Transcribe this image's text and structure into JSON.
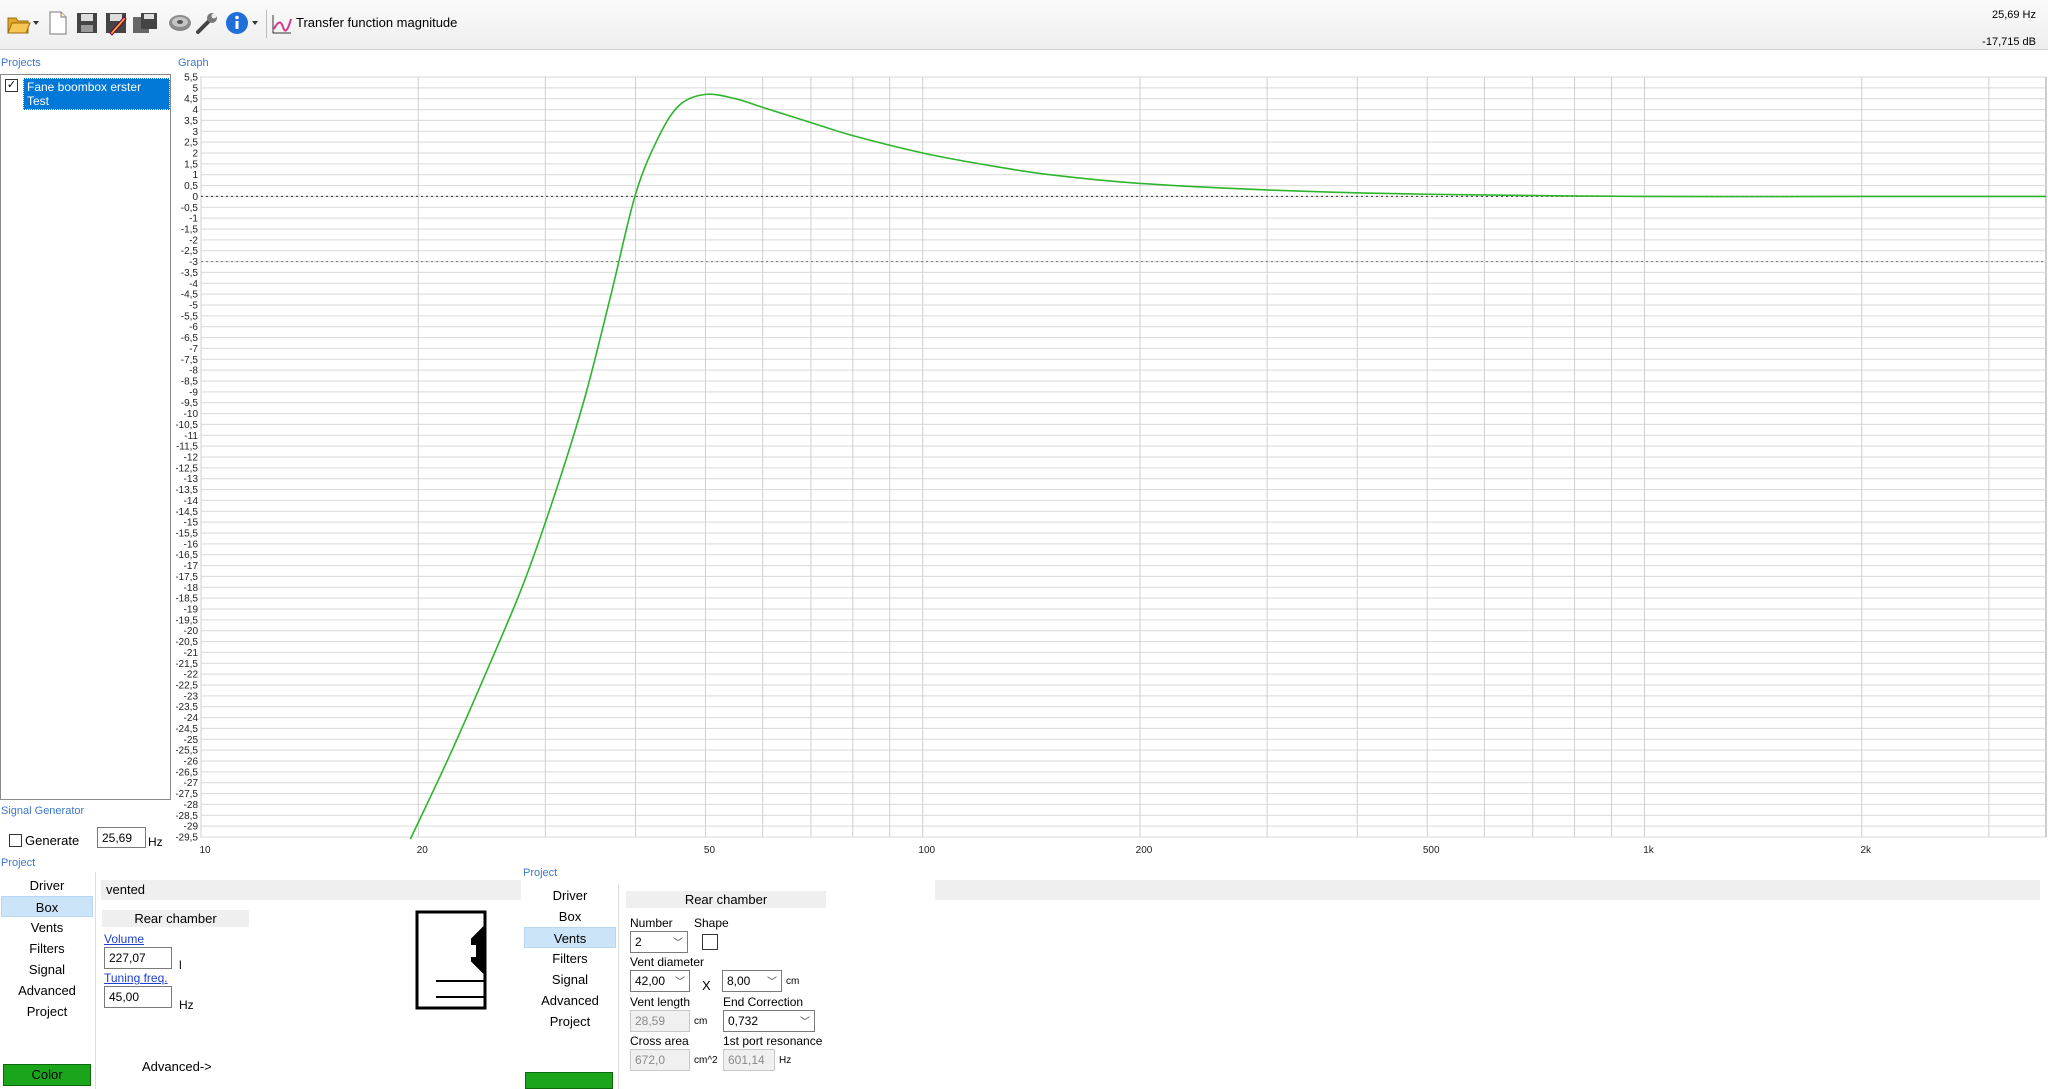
{
  "toolbar": {
    "title": "Transfer function magnitude",
    "readout_hz": "25,69 Hz",
    "readout_db": "-17,715 dB",
    "icons": [
      "open-folder-icon",
      "new-file-icon",
      "save-icon",
      "save-as-icon",
      "save-all-icon",
      "speaker-icon",
      "wrench-icon",
      "info-icon",
      "chart-icon"
    ]
  },
  "projects": {
    "label": "Projects",
    "items": [
      {
        "name": "Fane boombox erster Test",
        "checked": true
      }
    ]
  },
  "graph": {
    "label": "Graph"
  },
  "signal_generator": {
    "label": "Signal Generator",
    "generate_label": "Generate",
    "frequency": "25,69",
    "unit": "Hz"
  },
  "project_nav": {
    "label": "Project",
    "items": [
      "Driver",
      "Box",
      "Vents",
      "Filters",
      "Signal",
      "Advanced",
      "Project"
    ],
    "selected": "Box",
    "color_button": "Color"
  },
  "box_panel": {
    "type": "vented",
    "chamber": "Rear chamber",
    "volume_label": "Volume",
    "volume_value": "227,07",
    "volume_unit": "l",
    "tuning_label": "Tuning freq.",
    "tuning_value": "45,00",
    "tuning_unit": "Hz",
    "advanced_link": "Advanced->"
  },
  "vents_nav": {
    "label": "Project",
    "items": [
      "Driver",
      "Box",
      "Vents",
      "Filters",
      "Signal",
      "Advanced",
      "Project"
    ],
    "selected": "Vents"
  },
  "vents_panel": {
    "chamber": "Rear chamber",
    "number_label": "Number",
    "number_value": "2",
    "shape_label": "Shape",
    "diameter_label": "Vent diameter",
    "diameter_value": "42,00",
    "x_sep": "X",
    "second_value": "8,00",
    "cm": "cm",
    "length_label": "Vent length",
    "length_value": "28,59",
    "end_corr_label": "End Correction",
    "end_corr_value": "0,732",
    "cross_label": "Cross area",
    "cross_value": "672,0",
    "cross_unit": "cm^2",
    "resonance_label": "1st port resonance",
    "resonance_value": "601,14",
    "resonance_unit": "Hz"
  },
  "chart_data": {
    "type": "line",
    "title": "Transfer function magnitude",
    "xlabel": "",
    "ylabel": "",
    "x_scale": "log",
    "xlim": [
      10,
      3600
    ],
    "ylim": [
      -29.5,
      5.5
    ],
    "x_tick_labels": [
      {
        "v": 10,
        "t": "10"
      },
      {
        "v": 20,
        "t": "20"
      },
      {
        "v": 50,
        "t": "50"
      },
      {
        "v": 100,
        "t": "100"
      },
      {
        "v": 200,
        "t": "200"
      },
      {
        "v": 500,
        "t": "500"
      },
      {
        "v": 1000,
        "t": "1k"
      },
      {
        "v": 2000,
        "t": "2k"
      }
    ],
    "y_tick_labels": [
      "5,5",
      "5",
      "4,5",
      "4",
      "3,5",
      "3",
      "2,5",
      "2",
      "1,5",
      "1",
      "0,5",
      "0",
      "-0,5",
      "-1",
      "-1,5",
      "-2",
      "-2,5",
      "-3",
      "-3,5",
      "-4",
      "-4,5",
      "-5",
      "-5,5",
      "-6",
      "-6,5",
      "-7",
      "-7,5",
      "-8",
      "-8,5",
      "-9",
      "-9,5",
      "-10",
      "-10,5",
      "-11",
      "-11,5",
      "-12",
      "-12,5",
      "-13",
      "-13,5",
      "-14",
      "-14,5",
      "-15",
      "-15,5",
      "-16",
      "-16,5",
      "-17",
      "-17,5",
      "-18",
      "-18,5",
      "-19",
      "-19,5",
      "-20",
      "-20,5",
      "-21",
      "-21,5",
      "-22",
      "-22,5",
      "-23",
      "-23,5",
      "-24",
      "-24,5",
      "-25",
      "-25,5",
      "-26",
      "-26,5",
      "-27",
      "-27,5",
      "-28",
      "-28,5",
      "-29",
      "-29,5"
    ],
    "grid": true,
    "reference_lines": [
      0,
      -3
    ],
    "series": [
      {
        "color": "#2db52d",
        "x": [
          19.5,
          22,
          25,
          28,
          31,
          34,
          37,
          40,
          43,
          46,
          50,
          55,
          60,
          70,
          80,
          100,
          120,
          150,
          200,
          300,
          500,
          1000,
          2000,
          3600
        ],
        "y": [
          -29.6,
          -25.9,
          -21.7,
          -17.8,
          -13.6,
          -9.3,
          -4.5,
          0.1,
          2.7,
          4.2,
          4.7,
          4.5,
          4.1,
          3.4,
          2.8,
          2.0,
          1.5,
          1.0,
          0.6,
          0.3,
          0.1,
          0.0,
          0.0,
          0.0
        ]
      }
    ]
  }
}
